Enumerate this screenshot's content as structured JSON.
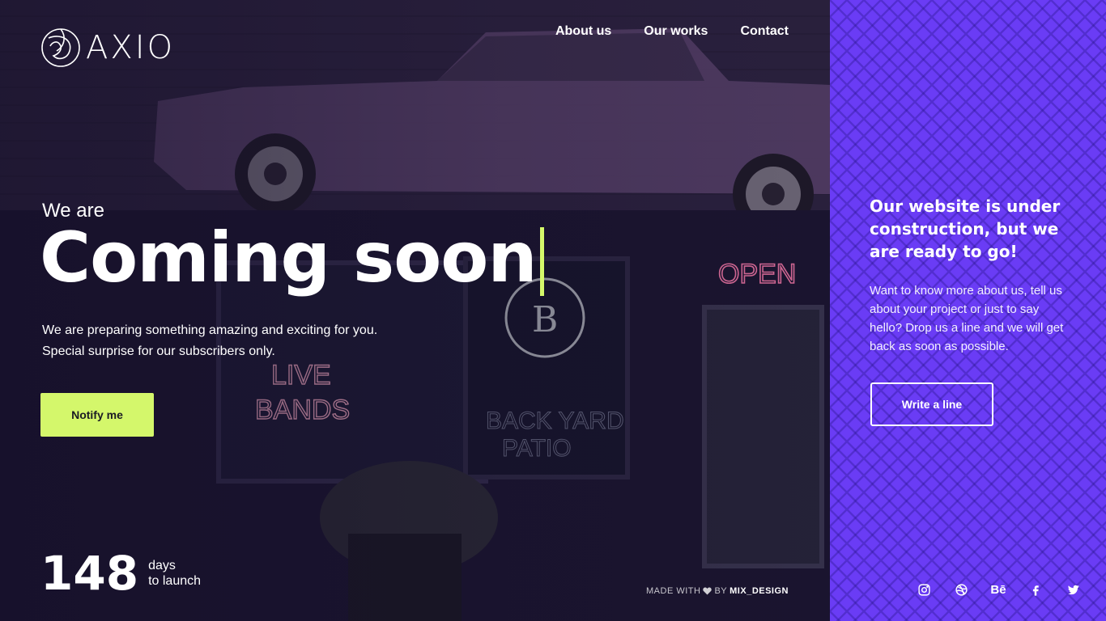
{
  "brand": {
    "name": "AXIO"
  },
  "nav": {
    "items": [
      "About us",
      "Our works",
      "Contact"
    ]
  },
  "hero": {
    "pre_title": "We are",
    "title": "Coming soon",
    "description_line1": "We are preparing something amazing and exciting for you.",
    "description_line2": "Special surprise for our subscribers only.",
    "notify_label": "Notify me",
    "accent_color": "#d4f76b"
  },
  "countdown": {
    "value": "148",
    "label_line1": "days",
    "label_line2": "to launch"
  },
  "credits": {
    "prefix": "MADE WITH",
    "by": "BY",
    "author": "MIX_DESIGN"
  },
  "side": {
    "title": "Our website is under construction, but we are ready to go!",
    "text": "Want to know more about us, tell us about your project or just to say hello? Drop us a line and we will get back as soon as possible.",
    "button_label": "Write a line",
    "background_color": "#6a3cf5",
    "socials": [
      {
        "name": "instagram-icon"
      },
      {
        "name": "dribbble-icon"
      },
      {
        "name": "behance-icon",
        "text": "Bē"
      },
      {
        "name": "facebook-icon"
      },
      {
        "name": "twitter-icon"
      }
    ]
  }
}
